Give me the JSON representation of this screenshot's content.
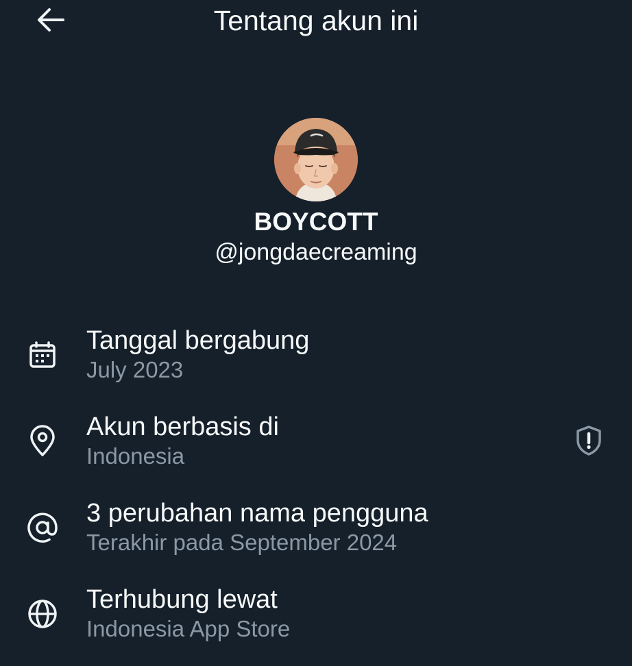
{
  "header": {
    "title": "Tentang akun ini",
    "back_icon": "arrow-left-icon"
  },
  "profile": {
    "display_name": "BOYCOTT",
    "handle": "@jongdaecreaming"
  },
  "info": [
    {
      "icon": "calendar-icon",
      "title": "Tanggal bergabung",
      "subtitle": "July 2023"
    },
    {
      "icon": "location-pin-icon",
      "title": "Akun berbasis di",
      "subtitle": "Indonesia",
      "action_icon": "shield-alert-icon"
    },
    {
      "icon": "at-sign-icon",
      "title": "3 perubahan nama pengguna",
      "subtitle": "Terakhir pada September 2024"
    },
    {
      "icon": "globe-icon",
      "title": "Terhubung lewat",
      "subtitle": "Indonesia App Store"
    }
  ],
  "colors": {
    "background": "#15202b",
    "primary_text": "#f7f9f9",
    "secondary_text": "#8b98a5",
    "icon_color": "#eff3f4"
  }
}
